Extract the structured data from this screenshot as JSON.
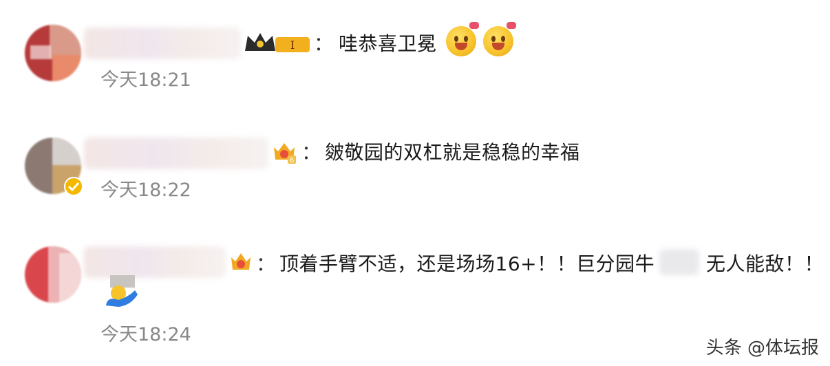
{
  "comments": [
    {
      "colon": "：",
      "text": "哇恭喜卫冕",
      "time": "今天18:21",
      "badge_icon": "crown-level-badge-icon",
      "badge_text": "I"
    },
    {
      "colon": "：",
      "text": "皴敬园的双杠就是稳稳的幸福",
      "time": "今天18:22",
      "badge_icon": "fan-crown-badge-icon",
      "badge_text": "6"
    },
    {
      "colon": "：",
      "text": "顶着手臂不适，还是场场16+！！巨分园牛",
      "text2": "无人能敌！！",
      "time": "今天18:24",
      "badge_icon": "fan-crown-badge-icon"
    }
  ],
  "watermark": "头条 @体坛报",
  "colors": {
    "time": "#888888",
    "text": "#1a1a1a",
    "crown": "#e8a21c",
    "verified": "#f5b800"
  }
}
